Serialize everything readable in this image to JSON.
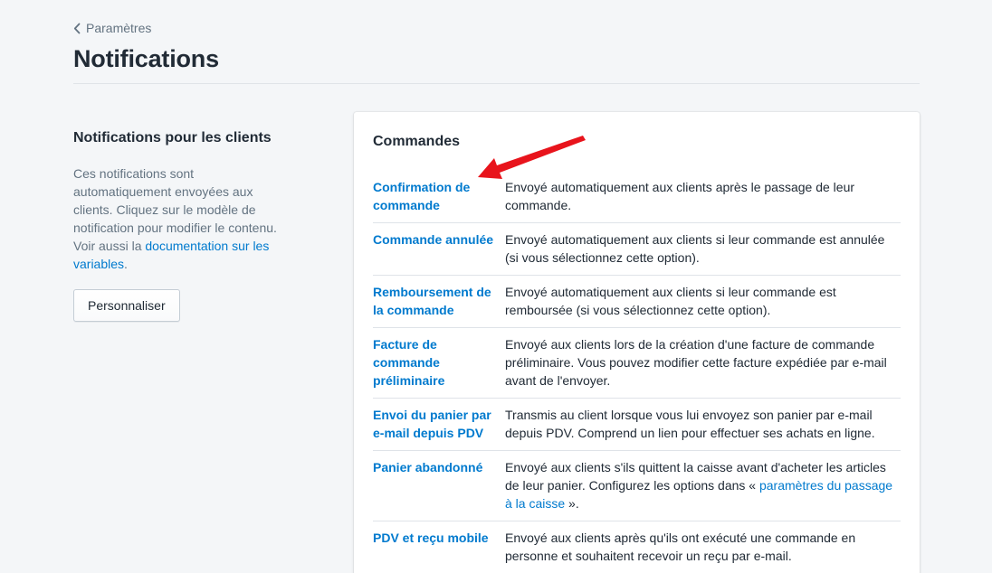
{
  "breadcrumb": {
    "label": "Paramètres"
  },
  "page": {
    "title": "Notifications"
  },
  "customers_section": {
    "heading": "Notifications pour les clients",
    "description": "Ces notifications sont automatiquement envoyées aux clients. Cliquez sur le modèle de notification pour modifier le contenu. Voir aussi la ",
    "link_label": "documentation sur les variables",
    "description_end": ".",
    "button_label": "Personnaliser"
  },
  "orders_card": {
    "heading": "Commandes",
    "rows": [
      {
        "name": "Confirmation de commande",
        "description": "Envoyé automatiquement aux clients après le passage de leur commande."
      },
      {
        "name": "Commande annulée",
        "description": "Envoyé automatiquement aux clients si leur commande est annulée (si vous sélectionnez cette option)."
      },
      {
        "name": "Remboursement de la commande",
        "description": "Envoyé automatiquement aux clients si leur commande est remboursée (si vous sélectionnez cette option)."
      },
      {
        "name": "Facture de commande préliminaire",
        "description": "Envoyé aux clients lors de la création d'une facture de commande préliminaire. Vous pouvez modifier cette facture expédiée par e-mail avant de l'envoyer."
      },
      {
        "name": "Envoi du panier par e-mail depuis PDV",
        "description": "Transmis au client lorsque vous lui envoyez son panier par e-mail depuis PDV. Comprend un lien pour effectuer ses achats en ligne."
      },
      {
        "name": "Panier abandonné",
        "description": "Envoyé aux clients s'ils quittent la caisse avant d'acheter les articles de leur panier. Configurez les options dans « ",
        "link": "paramètres du passage à la caisse",
        "description_end": " »."
      },
      {
        "name": "PDV et reçu mobile",
        "description": "Envoyé aux clients après qu'ils ont exécuté une commande en personne et souhaitent recevoir un reçu par e-mail."
      }
    ]
  },
  "colors": {
    "accent_link": "#007ace",
    "annotation_arrow": "#e8141c"
  },
  "icons": {
    "back": "chevron-left-icon",
    "annotation": "red-arrow-icon"
  }
}
